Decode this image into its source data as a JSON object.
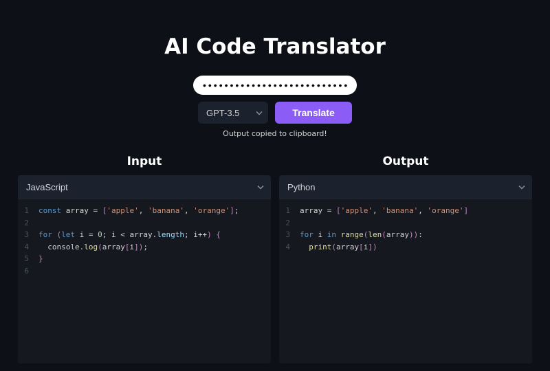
{
  "title": "AI Code Translator",
  "api_key": "•••••••••••••••••••••••••••••",
  "model_options": [
    "GPT-3.5"
  ],
  "model_selected": "GPT-3.5",
  "translate_button": "Translate",
  "status_message": "Output copied to clipboard!",
  "input": {
    "heading": "Input",
    "language": "JavaScript",
    "code_lines": [
      {
        "n": 1,
        "tokens": [
          [
            "kw",
            "const"
          ],
          [
            "sp",
            " "
          ],
          [
            "var",
            "array"
          ],
          [
            "sp",
            " "
          ],
          [
            "op",
            "="
          ],
          [
            "sp",
            " "
          ],
          [
            "paren",
            "["
          ],
          [
            "str",
            "'apple'"
          ],
          [
            "punc",
            ","
          ],
          [
            "sp",
            " "
          ],
          [
            "str",
            "'banana'"
          ],
          [
            "punc",
            ","
          ],
          [
            "sp",
            " "
          ],
          [
            "str",
            "'orange'"
          ],
          [
            "paren",
            "]"
          ],
          [
            "punc",
            ";"
          ]
        ]
      },
      {
        "n": 2,
        "tokens": []
      },
      {
        "n": 3,
        "tokens": [
          [
            "kw",
            "for"
          ],
          [
            "sp",
            " "
          ],
          [
            "paren",
            "("
          ],
          [
            "kw",
            "let"
          ],
          [
            "sp",
            " "
          ],
          [
            "var",
            "i"
          ],
          [
            "sp",
            " "
          ],
          [
            "op",
            "="
          ],
          [
            "sp",
            " "
          ],
          [
            "num",
            "0"
          ],
          [
            "punc",
            ";"
          ],
          [
            "sp",
            " "
          ],
          [
            "var",
            "i"
          ],
          [
            "sp",
            " "
          ],
          [
            "op",
            "<"
          ],
          [
            "sp",
            " "
          ],
          [
            "var",
            "array"
          ],
          [
            "punc",
            "."
          ],
          [
            "prop",
            "length"
          ],
          [
            "punc",
            ";"
          ],
          [
            "sp",
            " "
          ],
          [
            "var",
            "i"
          ],
          [
            "op",
            "++"
          ],
          [
            "paren",
            ")"
          ],
          [
            "sp",
            " "
          ],
          [
            "paren",
            "{"
          ]
        ]
      },
      {
        "n": 4,
        "tokens": [
          [
            "sp",
            "  "
          ],
          [
            "var",
            "console"
          ],
          [
            "punc",
            "."
          ],
          [
            "fn",
            "log"
          ],
          [
            "paren",
            "("
          ],
          [
            "var",
            "array"
          ],
          [
            "paren",
            "["
          ],
          [
            "var",
            "i"
          ],
          [
            "paren",
            "]"
          ],
          [
            "paren",
            ")"
          ],
          [
            "punc",
            ";"
          ]
        ]
      },
      {
        "n": 5,
        "tokens": [
          [
            "paren",
            "}"
          ]
        ]
      },
      {
        "n": 6,
        "tokens": []
      }
    ]
  },
  "output": {
    "heading": "Output",
    "language": "Python",
    "code_lines": [
      {
        "n": 1,
        "tokens": [
          [
            "var",
            "array"
          ],
          [
            "sp",
            " "
          ],
          [
            "op",
            "="
          ],
          [
            "sp",
            " "
          ],
          [
            "paren",
            "["
          ],
          [
            "str",
            "'apple'"
          ],
          [
            "punc",
            ","
          ],
          [
            "sp",
            " "
          ],
          [
            "str",
            "'banana'"
          ],
          [
            "punc",
            ","
          ],
          [
            "sp",
            " "
          ],
          [
            "str",
            "'orange'"
          ],
          [
            "paren",
            "]"
          ]
        ]
      },
      {
        "n": 2,
        "tokens": []
      },
      {
        "n": 3,
        "tokens": [
          [
            "kw",
            "for"
          ],
          [
            "sp",
            " "
          ],
          [
            "var",
            "i"
          ],
          [
            "sp",
            " "
          ],
          [
            "kw",
            "in"
          ],
          [
            "sp",
            " "
          ],
          [
            "fn",
            "range"
          ],
          [
            "paren",
            "("
          ],
          [
            "fn",
            "len"
          ],
          [
            "paren",
            "("
          ],
          [
            "var",
            "array"
          ],
          [
            "paren",
            ")"
          ],
          [
            "paren",
            ")"
          ],
          [
            "punc",
            ":"
          ]
        ]
      },
      {
        "n": 4,
        "tokens": [
          [
            "sp",
            "  "
          ],
          [
            "fn",
            "print"
          ],
          [
            "paren",
            "("
          ],
          [
            "var",
            "array"
          ],
          [
            "paren",
            "["
          ],
          [
            "var",
            "i"
          ],
          [
            "paren",
            "]"
          ],
          [
            "paren",
            ")"
          ]
        ]
      }
    ]
  }
}
